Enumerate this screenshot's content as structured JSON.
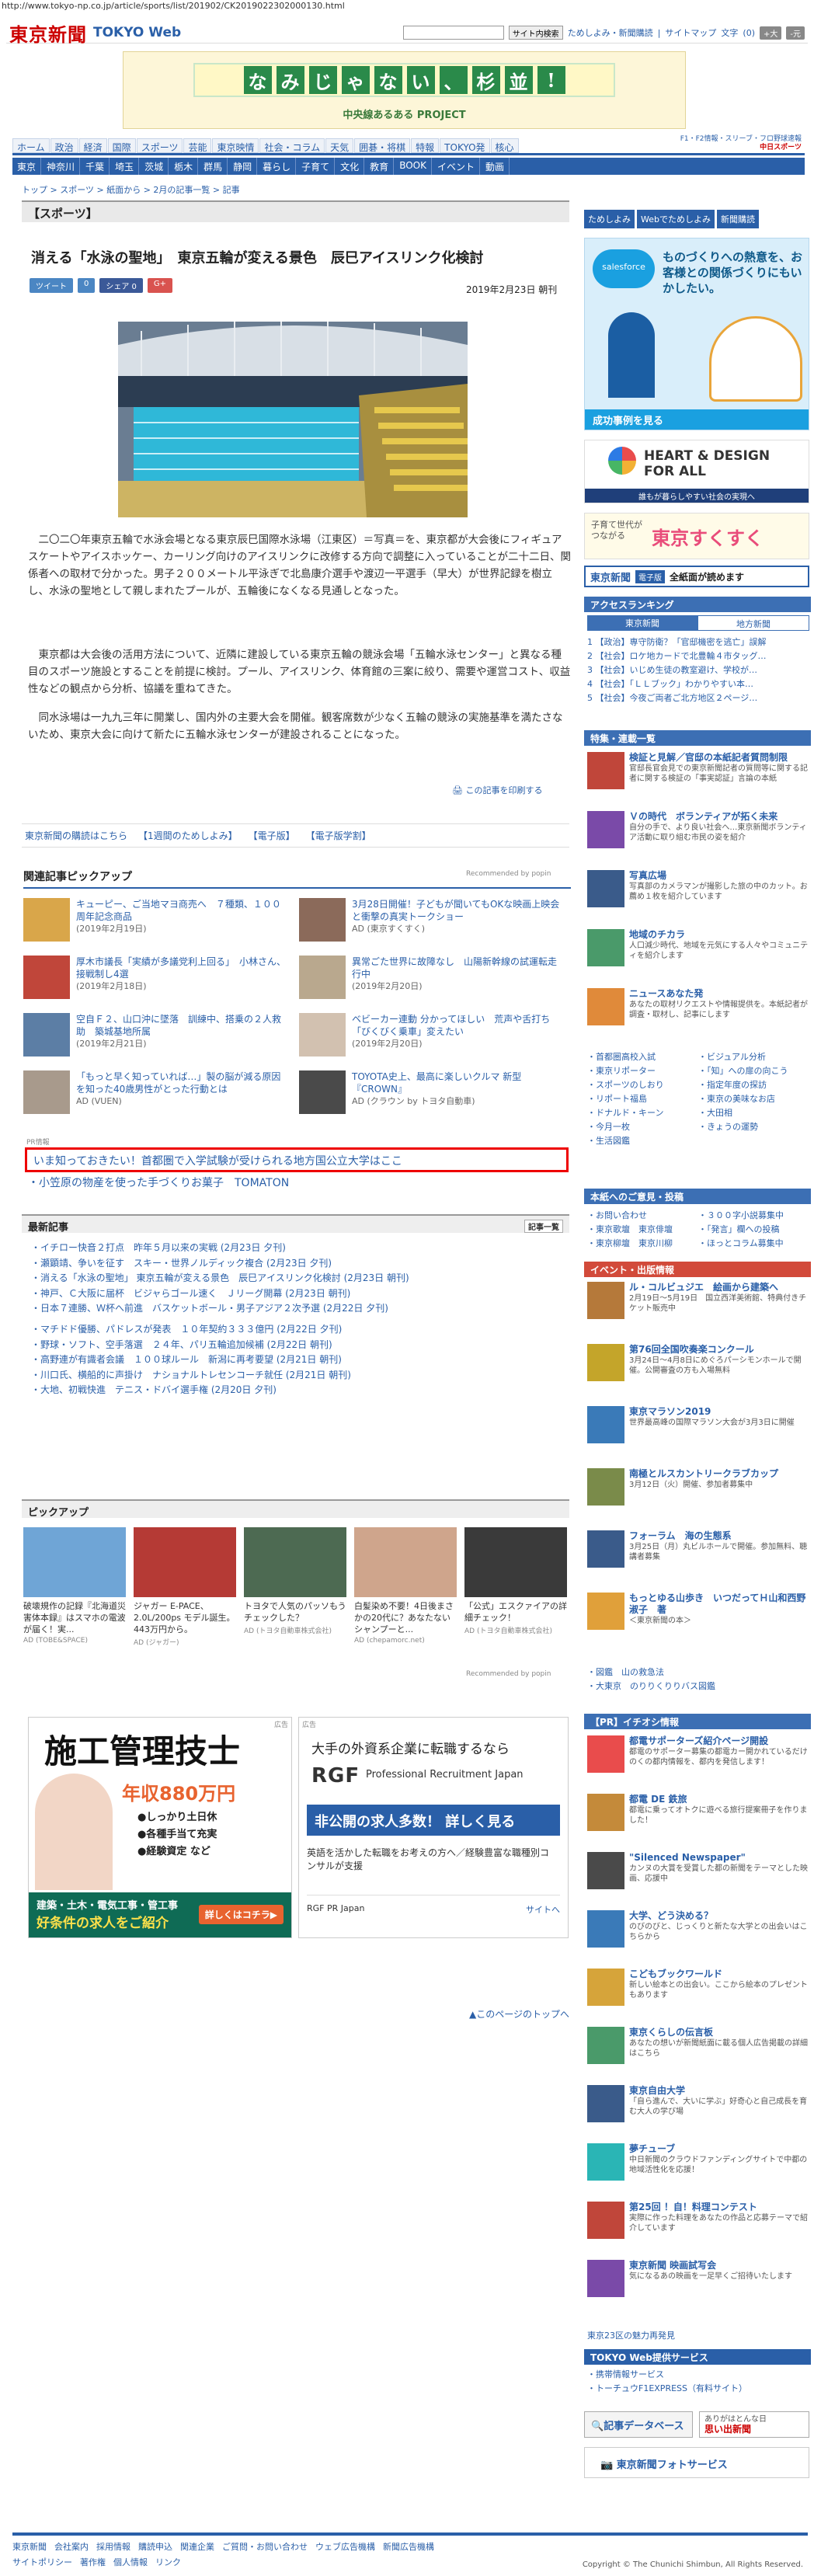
{
  "url": "http://www.tokyo-np.co.jp/article/sports/list/201902/CK2019022302000130.html",
  "header": {
    "logo": "東京新聞",
    "logo_sub": "TOKYO Web",
    "search_btn": "サイト内検索",
    "links": [
      "ためしよみ・新聞購読",
      "サイトマップ"
    ],
    "font_label": "文字",
    "font_size": "(0)",
    "font_up": "+大",
    "font_down": "-元"
  },
  "banner": {
    "main": [
      "な",
      "み",
      "じ",
      "ゃ",
      "な",
      "い",
      "、",
      "杉",
      "並",
      "!"
    ],
    "sub": "中央線あるある PROJECT"
  },
  "nav1": [
    "ホーム",
    "政治",
    "経済",
    "国際",
    "スポーツ",
    "芸能",
    "東京映情",
    "社会・コラム",
    "天気",
    "囲碁・将棋",
    "特報",
    "TOKYO発",
    "核心"
  ],
  "nav2": [
    "東京",
    "神奈川",
    "千葉",
    "埼玉",
    "茨城",
    "栃木",
    "群馬",
    "静岡",
    "暮らし",
    "子育て",
    "文化",
    "教育",
    "BOOK",
    "イベント",
    "動画"
  ],
  "nav_right": [
    "F1・F2情報・スリーブ・フロ野球速報",
    "中日スポーツ"
  ],
  "breadcrumb": "トップ > スポーツ > 紙面から > 2月の記事一覧 > 記事",
  "section": "【スポーツ】",
  "article": {
    "title": "消える「水泳の聖地」　東京五輪が変える景色　辰巳アイスリンク化検討",
    "date": "2019年2月23日 朝刊",
    "share": [
      "ツイート",
      "0",
      "シェア 0",
      "G+"
    ],
    "p1": "二〇二〇年東京五輪で水泳会場となる東京辰巳国際水泳場（江東区）＝写真＝を、東京都が大会後にフィギュアスケートやアイスホッケー、カーリング向けのアイスリンクに改修する方向で調整に入っていることが二十二日、関係者への取材で分かった。男子２００メートル平泳ぎで北島康介選手や渡辺一平選手（早大）が世界記録を樹立し、水泳の聖地として親しまれたプールが、五輪後になくなる見通しとなった。",
    "p2": "東京都は大会後の活用方法について、近隣に建設している東京五輪の競泳会場「五輪水泳センター」と異なる種目のスポーツ施設とすることを前提に検討。プール、アイスリンク、体育館の三案に絞り、需要や運営コスト、収益性などの観点から分析、協議を重ねてきた。",
    "p3": "同水泳場は一九九三年に開業し、国内外の主要大会を開催。観客席数が少なく五輪の競泳の実施基準を満たさないため、東京大会に向けて新たに五輪水泳センターが建設されることになった。",
    "print": "この記事を印刷する"
  },
  "bottom_links": [
    "東京新聞の購読はこちら",
    "【1週間のためしよみ】",
    "【電子版】",
    "【電子版学割】"
  ],
  "related": {
    "title": "関連記事ピックアップ",
    "rec": "Recommended by popin",
    "items": [
      {
        "text": "キューピー、ご当地マヨ商売へ　７種類、１００周年記念商品",
        "date": "(2019年2月19日)"
      },
      {
        "text": "3月28日開催！子どもが聞いてもOKな映画上映会と衝撃の真実トークショー",
        "date": "AD (東京すくすく)"
      },
      {
        "text": "厚木市議長「実績が多議党利上回る」　小林さん、接戦制し4選",
        "date": "(2019年2月18日)"
      },
      {
        "text": "異常ごた世界に故障なし　山陽新幹線の試運転走行中",
        "date": "(2019年2月20日)"
      },
      {
        "text": "空自Ｆ２、山口沖に墜落　訓練中、搭乗の２人救助　築城基地所属",
        "date": "(2019年2月21日)"
      },
      {
        "text": "ベビーカー連動 分かってほしい　荒声や舌打ち「びくびく乗車」変えたい",
        "date": "(2019年2月20日)"
      },
      {
        "text": "「もっと早く知っていれば…」製の脳が減る原因を知った40歳男性がとった行動とは",
        "date": "AD (VUEN)"
      },
      {
        "text": "TOYOTA史上、最高に楽しいクルマ 新型『CROWN』",
        "date": "AD (クラウン by トヨタ自動車)"
      }
    ]
  },
  "pr": {
    "label": "PR情報",
    "line1": "いま知っておきたい！首都圏で入学試験が受けられる地方国公立大学はここ",
    "line2": "小笠原の物産を使った手づくりお菓子　TOMATON"
  },
  "latest": {
    "title": "最新記事",
    "more": "記事一覧",
    "list1": [
      "イチロー快音２打点　昨年５月以来の実戦 (2月23日 夕刊)",
      "瀬顕靖、争いを征す　スキー・世界ノルディック複合 (2月23日 夕刊)",
      "消える「水泳の聖地」 東京五輪が変える景色　辰巳アイスリンク化検討 (2月23日 朝刊)",
      "神戸、Ｃ大阪に届杯　ビジャらゴール速く　Ｊリーグ開幕 (2月23日 朝刊)",
      "日本７連勝、Ｗ杯へ前進　バスケットボール・男子アジア２次予選 (2月22日 夕刊)"
    ],
    "list2": [
      "マチドド優勝、パドレスが発表　１０年契約３３３億円 (2月22日 夕刊)",
      "野球・ソフト、空手落選　２４年、パリ五輪追加候補 (2月22日 朝刊)",
      "高野連が有識者会議　１００球ルール　新潟に再考要望 (2月21日 朝刊)",
      "川口氏、横船的に声掛け　ナショナルトレセンコーチ就任 (2月21日 朝刊)",
      "大地、初戦快進　テニス・ドバイ選手権 (2月20日 夕刊)"
    ]
  },
  "pickup": {
    "title": "ピックアップ",
    "rec": "Recommended by popin",
    "items": [
      {
        "text": "破壊規作の記録『北海道災害体本録』はスマホの電波が届く！実...",
        "src": "AD (TOBE&SPACE)"
      },
      {
        "text": "ジャガー E-PACE、2.0L/200ps モデル誕生。443万円から。",
        "src": "AD (ジャガー)"
      },
      {
        "text": "トヨタで人気のパッソもうチェックした？",
        "src": "AD (トヨタ自動車株式会社)"
      },
      {
        "text": "白髪染め不要！4日後まさかの20代に？あなたないシャンプーと...",
        "src": "AD (chepamorc.net)"
      },
      {
        "text": "「公式」エスクァイアの詳細チェック！",
        "src": "AD (トヨタ自動車株式会社)"
      }
    ]
  },
  "ad1": {
    "title": "施工管理技士",
    "salary": "年収880万円",
    "items": [
      "●しっかり土日休",
      "●各種手当て充実",
      "●経験資定 など"
    ],
    "bottom": "建築・土木・電気工事・管工事",
    "bottom2": "好条件の求人をご紹介",
    "btn": "詳しくはコチラ▶",
    "tag": "広告"
  },
  "ad2": {
    "tag": "広告",
    "h": "大手の外資系企業に転職するなら",
    "brand": "RGF",
    "brand2": "Professional Recruitment Japan",
    "cta": "非公開の求人多数！ 詳しく見る",
    "desc": "英語を活かした転職をお考えの方へ／経験豊富な職種別コンサルが支援",
    "footer": "RGF PR Japan",
    "site": "サイトへ"
  },
  "totop": "このページのトップへ",
  "sidebar": {
    "btns": [
      "ためしよみ",
      "Webでためしよみ",
      "新聞購読"
    ],
    "salesforce": {
      "brand": "salesforce",
      "h": "ものづくりへの熱意を、お客様との関係づくりにもいかしたい。",
      "cta": "成功事例を見る"
    },
    "heart": {
      "h": "HEART & DESIGN FOR ALL",
      "s": "誰もが暮らしやすい社会の実現へ"
    },
    "sukusuku": {
      "h": "子育て世代がつながる",
      "brand": "東京すくすく"
    },
    "denshi": {
      "brand": "東京新聞",
      "tag": "電子版",
      "h": "全紙面が読めます"
    },
    "ranking": {
      "title": "アクセスランキング",
      "tab1": "東京新聞",
      "tab2": "地方新聞",
      "items": [
        "【政治】専守防衛？「官邸機密を逃亡」誤解　",
        "【社会】ロケ地カードで北豊輪４市タッグ…",
        "【社会】いじめ生徒の教室避け、学校が…",
        "【社会】「ＬＬブック」わかりやすい本…",
        "【社会】今夜ご両者ご北方地区２ページ…"
      ]
    },
    "special": {
      "title": "特集・連載一覧",
      "items": [
        {
          "t": "検証と見解／官邸の本紙記者質問制限",
          "d": "官邸長官会見での東京新聞記者の質問等に関する記者に関する検証の「事実認証」言論の本紙"
        },
        {
          "t": "Ｖの時代　ボランティアが拓く未来",
          "d": "自分の手で、より良い社会へ…東京新聞ボランティア活動に取り組む市民の姿を紹介"
        },
        {
          "t": "写真広場",
          "d": "写真部のカメラマンが撮影した旅の中のカット。お薦め１枚を紹介しています"
        },
        {
          "t": "地域のチカラ",
          "d": "人口減少時代、地域を元気にする人々やコミュニティを紹介します"
        },
        {
          "t": "ニュースあなた発",
          "d": "あなたの取材リクエストや情報提供を。本紙記者が調査・取材し、記事にします"
        }
      ]
    },
    "links": [
      "首都圏高校入試",
      "ビジュアル分析",
      "東京リポーター",
      "「知」への扉の向こう",
      "スポーツのしおり",
      "指定年度の探訪",
      "リポート福島",
      "東京の美味なお店",
      "ドナルド・キーン",
      "大田相",
      "今月一枚",
      "きょうの運勢",
      "生活図鑑"
    ],
    "invite": {
      "title": "本紙へのご意見・投稿",
      "items": [
        "お問い合わせ",
        "３００字小説募集中",
        "東京歌壇　東京俳壇",
        "「発言」欄への投稿",
        "東京柳壇　東京川柳",
        "ほっとコラム募集中"
      ]
    },
    "events": {
      "title": "イベント・出版情報",
      "items": [
        {
          "t": "ル・コルビュジエ　絵画から建築へ",
          "d": "2月19日～5月19日　国立西洋美術館、特典付きチケット販売中"
        },
        {
          "t": "第76回全国吹奏楽コンクール",
          "d": "3月24日～4月8日にめぐろパーシモンホールで開催。公開審査の方も入場無料"
        },
        {
          "t": "東京マラソン2019",
          "d": "世界最高峰の国際マラソン大会が3月3日に開催"
        },
        {
          "t": "南極とルスカントリークラブカップ",
          "d": "3月12日（火）開催、参加者募集中"
        },
        {
          "t": "フォーラム　海の生態系",
          "d": "3月25日（月）丸ビルホールで開催。参加無料、聴講者募集"
        },
        {
          "t": "もっとゆる山歩き　いつだってＨ山和西野淑子　著",
          "d": "＜東京新聞の本＞"
        }
      ]
    },
    "event_links": [
      "図鑑　山の救急法",
      "大東京　のりりくりりバス図鑑"
    ],
    "pr": {
      "title": "【PR】イチオシ情報",
      "items": [
        {
          "t": "都電サポーターズ紹介ページ開設",
          "d": "都電のサポーター募集の都電カー開かれているだけのくの都内情報を、都内を発信します！"
        },
        {
          "t": "都電 DE 鉄旅",
          "d": "都電に乗ってオトクに遊べる旅行提案冊子を作りました！"
        },
        {
          "t": "\"Silenced Newspaper\"",
          "d": "カンヌの大賞を受賞した都の新聞をテーマとした映画、応援中"
        },
        {
          "t": "大学、どう決める？",
          "d": "のびのびと、じっくりと新たな大学との出会いはこちらから"
        },
        {
          "t": "こどもブックワールド",
          "d": "新しい絵本との出会い。ここから絵本のプレゼントもあります"
        },
        {
          "t": "東京くらしの伝言板",
          "d": "あなたの想いが新聞紙面に載る個人広告掲載の詳細はこちら"
        },
        {
          "t": "東京自由大学",
          "d": "「自ら進んで、大いに学ぶ」好奇心と自己成長を育む大人の学び場"
        },
        {
          "t": "夢チューブ",
          "d": "中日新聞のクラウドファンディングサイトで中都の地域活性化を応援！"
        },
        {
          "t": "第25回 ！自！料理コンテスト",
          "d": "実際に作った料理をあなたの作品と応募テーマで紹介しています"
        },
        {
          "t": "東京新聞 映画試写会",
          "d": "気になるあの映画を一足早くご招待いたします"
        }
      ]
    },
    "tokyo23": "東京23区の魅力再発見",
    "web_service": {
      "title": "TOKYO Web提供サービス",
      "items": [
        "携帯情報サービス",
        "トーチュウF1EXPRESS（有料サイト）"
      ]
    },
    "db": "記事データベース",
    "ads": [
      "ありがはとんな日",
      "思い出新聞"
    ],
    "photo": "東京新聞フォトサービス"
  },
  "footer": {
    "links1": [
      "東京新聞",
      "会社案内",
      "採用情報",
      "購読申込",
      "関連企業",
      "ご質問・お問い合わせ",
      "ウェブ広告機構",
      "新聞広告機構"
    ],
    "links2": [
      "サイトポリシー",
      "著作権",
      "個人情報",
      "リンク"
    ],
    "copyright": "Copyright © The Chunichi Shimbun, All Rights Reserved."
  }
}
